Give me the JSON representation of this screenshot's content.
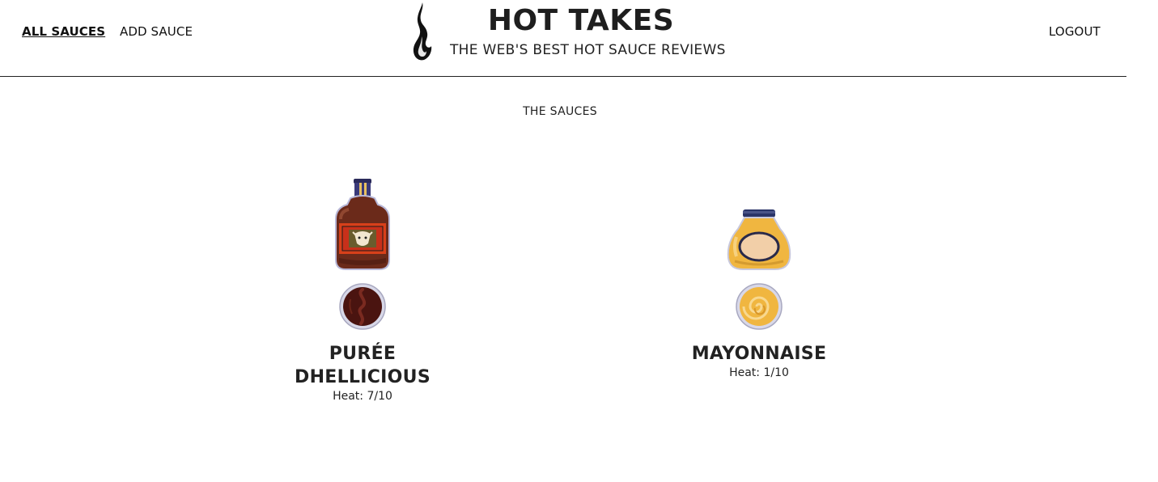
{
  "nav": {
    "all_sauces": "ALL SAUCES",
    "add_sauce": "ADD SAUCE",
    "logout": "LOGOUT"
  },
  "brand": {
    "title": "HOT TAKES",
    "subtitle": "THE WEB'S BEST HOT SAUCE REVIEWS",
    "logo_icon": "flame-icon"
  },
  "main": {
    "section_title": "THE SAUCES",
    "sauces": [
      {
        "name": "PURÉE DHELLICIOUS",
        "heat_text": "Heat: 7/10",
        "bottle_icon": "hot-sauce-bottle-icon",
        "bowl_icon": "dark-sauce-bowl-icon"
      },
      {
        "name": "MAYONNAISE",
        "heat_text": "Heat: 1/10",
        "bottle_icon": "mayonnaise-jar-icon",
        "bowl_icon": "mayonnaise-bowl-icon"
      }
    ]
  },
  "colors": {
    "text": "#222222",
    "header_border": "#222222",
    "bottle_brown": "#6b2a1a",
    "mayo_yellow": "#f0b640"
  }
}
